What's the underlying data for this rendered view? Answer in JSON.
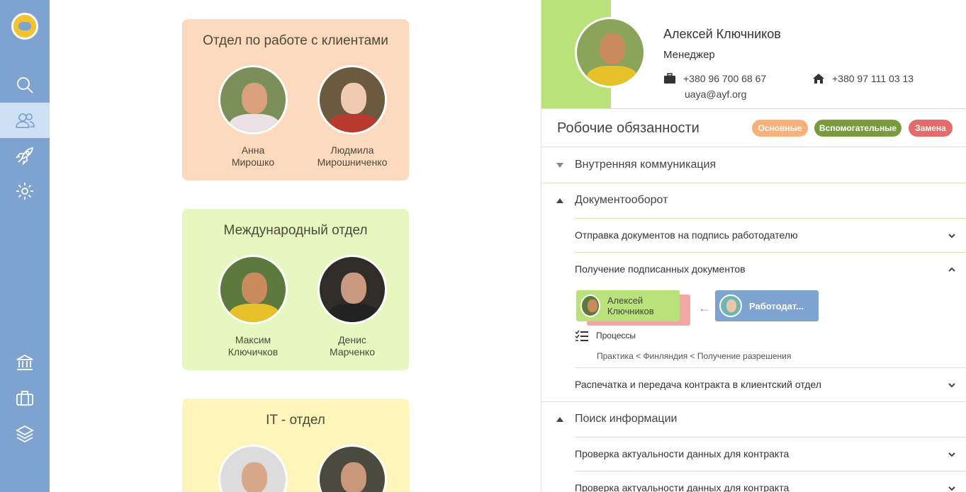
{
  "sidebar": {
    "items": [
      {
        "icon": "search-icon"
      },
      {
        "icon": "users-icon"
      },
      {
        "icon": "rocket-icon"
      },
      {
        "icon": "gear-icon"
      },
      {
        "icon": "bank-icon"
      },
      {
        "icon": "briefcase-icon"
      },
      {
        "icon": "layers-icon"
      }
    ]
  },
  "departments": [
    {
      "title": "Отдел по работе с клиентами",
      "color": "#fdd9bd",
      "members": [
        {
          "first": "Анна",
          "last": "Мирошко"
        },
        {
          "first": "Людмила",
          "last": "Мирошниченко"
        }
      ]
    },
    {
      "title": "Международный отдел",
      "color": "#e6f7bf",
      "members": [
        {
          "first": "Максим",
          "last": "Ключичков"
        },
        {
          "first": "Денис",
          "last": "Марченко"
        }
      ]
    },
    {
      "title": "IT - отдел",
      "color": "#fdf5b9",
      "members": []
    }
  ],
  "profile": {
    "name": "Алексей Ключников",
    "role": "Менеджер",
    "phone_work": "+380 96 700 68 67",
    "phone_home": "+380 97 111 03 13",
    "email": "uaya@ayf.org"
  },
  "duties": {
    "title": "Робочие обязанности",
    "badges": [
      {
        "label": "Основные",
        "color": "#f8b17a"
      },
      {
        "label": "Вспомогательные",
        "color": "#7a9a3e"
      },
      {
        "label": "Замена",
        "color": "#e56b6b"
      }
    ],
    "sections": [
      {
        "label": "Внутренняя коммуникация"
      },
      {
        "label": "Документооборот"
      },
      {
        "label": "Поиск информации"
      }
    ],
    "tasks": [
      {
        "label": "Отправка документов на подпись работодателю"
      },
      {
        "label": "Получение подписанных документов"
      },
      {
        "label": "Распечатка и передача контракта в клиентский отдел"
      },
      {
        "label": "Проверка актуальности данных для контракта"
      },
      {
        "label": "Проверка актуальности данных для контракта"
      }
    ],
    "flow": {
      "from": "Алексей Ключников",
      "to": "Работодат..."
    },
    "processes_label": "Процессы",
    "process_path": "Практика < Финляндия < Получение разрешения"
  }
}
